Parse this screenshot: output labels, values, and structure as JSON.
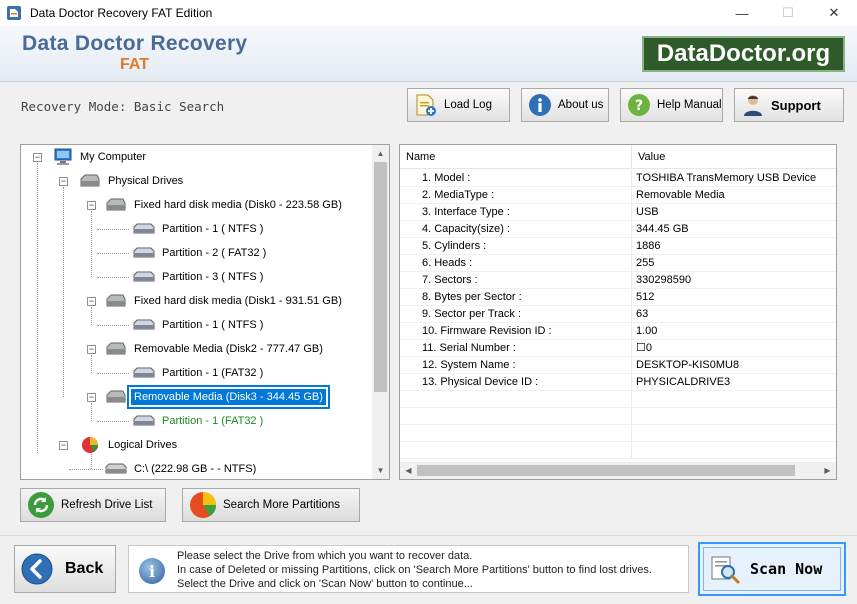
{
  "window": {
    "title": "Data Doctor Recovery FAT Edition",
    "controls": {
      "minimize": "—",
      "maximize": "☐",
      "close": "✕"
    }
  },
  "banner": {
    "title": "Data Doctor Recovery",
    "subtitle": "FAT",
    "logo": "DataDoctor.org"
  },
  "toolbar": {
    "mode": "Recovery Mode: Basic Search",
    "load_log": "Load Log",
    "about_us": "About us",
    "help_manual": "Help Manual",
    "support": "Support"
  },
  "tree": {
    "my_computer": "My Computer",
    "physical_drives": "Physical Drives",
    "disk0": "Fixed hard disk media (Disk0 - 223.58 GB)",
    "disk0_p1": "Partition - 1 ( NTFS )",
    "disk0_p2": "Partition - 2 ( FAT32 )",
    "disk0_p3": "Partition - 3 ( NTFS )",
    "disk1": "Fixed hard disk media (Disk1 - 931.51 GB)",
    "disk1_p1": "Partition - 1 ( NTFS )",
    "disk2": "Removable Media (Disk2 - 777.47 GB)",
    "disk2_p1": "Partition - 1 (FAT32 )",
    "disk3": "Removable Media (Disk3 - 344.45 GB)",
    "disk3_p1": "Partition - 1 (FAT32 )",
    "logical_drives": "Logical Drives",
    "c_drive": "C:\\ (222.98 GB -  - NTFS)"
  },
  "properties": {
    "col_name": "Name",
    "col_value": "Value",
    "rows": [
      {
        "name": "1. Model :",
        "value": "TOSHIBA TransMemory USB Device"
      },
      {
        "name": "2. MediaType :",
        "value": "Removable Media"
      },
      {
        "name": "3. Interface Type :",
        "value": "USB"
      },
      {
        "name": "4. Capacity(size) :",
        "value": "344.45 GB"
      },
      {
        "name": "5. Cylinders :",
        "value": "1886"
      },
      {
        "name": "6. Heads :",
        "value": "255"
      },
      {
        "name": "7. Sectors :",
        "value": "330298590"
      },
      {
        "name": "8. Bytes per Sector :",
        "value": "512"
      },
      {
        "name": "9. Sector per Track :",
        "value": "63"
      },
      {
        "name": "10. Firmware Revision ID :",
        "value": "1.00"
      },
      {
        "name": "11. Serial Number :",
        "value": "☐0"
      },
      {
        "name": "12. System Name :",
        "value": "DESKTOP-KIS0MU8"
      },
      {
        "name": "13. Physical Device ID :",
        "value": "PHYSICALDRIVE3"
      }
    ]
  },
  "actions": {
    "refresh": "Refresh Drive List",
    "search_more": "Search More Partitions"
  },
  "bottom": {
    "back": "Back",
    "info_line1": "Please select the Drive from which you want to recover data.",
    "info_line2": "In case of Deleted or missing Partitions, click on 'Search More Partitions' button to find lost drives.",
    "info_line3": "Select the Drive and click on 'Scan Now' button to continue...",
    "scan_now": "Scan Now"
  },
  "colors": {
    "selection": "#0078d7",
    "brand_blue": "#4a6b96",
    "brand_orange": "#e07a2a",
    "logo_green": "#2f5b2a",
    "partition_green": "#1e8a1e"
  }
}
